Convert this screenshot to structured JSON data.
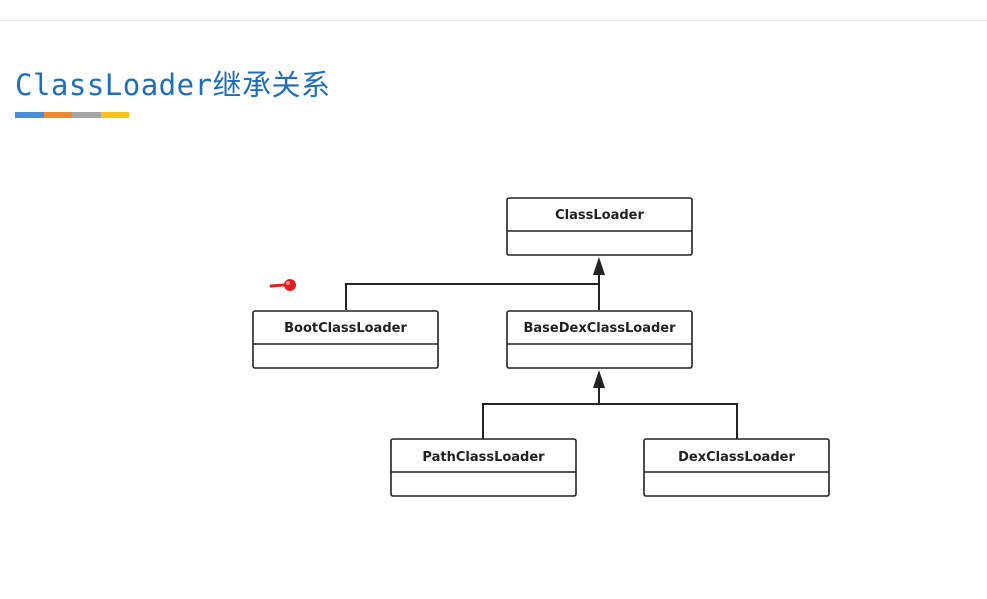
{
  "slide": {
    "title": "ClassLoader继承关系",
    "title_color": "#1f6fb8",
    "accent_bar_colors": [
      "#4a90d9",
      "#f0872e",
      "#a6a6a6",
      "#f7c21a"
    ]
  },
  "diagram": {
    "type": "class-inheritance",
    "nodes": [
      {
        "id": "classloader",
        "label": "ClassLoader"
      },
      {
        "id": "bootclassloader",
        "label": "BootClassLoader"
      },
      {
        "id": "basedexclassloader",
        "label": "BaseDexClassLoader"
      },
      {
        "id": "pathclassloader",
        "label": "PathClassLoader"
      },
      {
        "id": "dexclassloader",
        "label": "DexClassLoader"
      }
    ],
    "edges": [
      {
        "from": "bootclassloader",
        "to": "classloader",
        "kind": "extends"
      },
      {
        "from": "basedexclassloader",
        "to": "classloader",
        "kind": "extends"
      },
      {
        "from": "pathclassloader",
        "to": "basedexclassloader",
        "kind": "extends"
      },
      {
        "from": "dexclassloader",
        "to": "basedexclassloader",
        "kind": "extends"
      }
    ]
  },
  "pointer": {
    "icon": "laser-pointer-icon",
    "color": "#e02020"
  }
}
